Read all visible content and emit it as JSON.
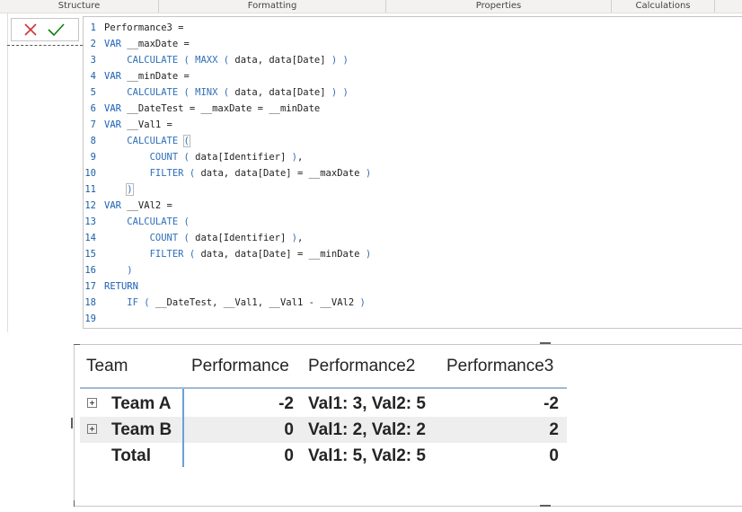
{
  "ribbon": {
    "sections": [
      "Structure",
      "Formatting",
      "Properties",
      "Calculations"
    ]
  },
  "formula_bar": {
    "cancel_icon": "close-icon",
    "commit_icon": "checkmark-icon",
    "lines": [
      {
        "num": "1",
        "tokens": [
          {
            "t": "pl",
            "v": "Performance3 ="
          }
        ]
      },
      {
        "num": "2",
        "tokens": [
          {
            "t": "kw",
            "v": "VAR"
          },
          {
            "t": "pl",
            "v": " __maxDate ="
          }
        ]
      },
      {
        "num": "3",
        "tokens": [
          {
            "t": "pl",
            "v": "    "
          },
          {
            "t": "fn",
            "v": "CALCULATE ( MAXX ("
          },
          {
            "t": "pl",
            "v": " data, data[Date] "
          },
          {
            "t": "fn",
            "v": ") )"
          }
        ]
      },
      {
        "num": "4",
        "tokens": [
          {
            "t": "kw",
            "v": "VAR"
          },
          {
            "t": "pl",
            "v": " __minDate ="
          }
        ]
      },
      {
        "num": "5",
        "tokens": [
          {
            "t": "pl",
            "v": "    "
          },
          {
            "t": "fn",
            "v": "CALCULATE ( MINX ("
          },
          {
            "t": "pl",
            "v": " data, data[Date] "
          },
          {
            "t": "fn",
            "v": ") )"
          }
        ]
      },
      {
        "num": "6",
        "tokens": [
          {
            "t": "kw",
            "v": "VAR"
          },
          {
            "t": "pl",
            "v": " __DateTest = __maxDate = __minDate"
          }
        ]
      },
      {
        "num": "7",
        "tokens": [
          {
            "t": "kw",
            "v": "VAR"
          },
          {
            "t": "pl",
            "v": " __Val1 ="
          }
        ]
      },
      {
        "num": "8",
        "tokens": [
          {
            "t": "pl",
            "v": "    "
          },
          {
            "t": "fn",
            "v": "CALCULATE "
          },
          {
            "t": "hl",
            "v": "("
          }
        ]
      },
      {
        "num": "9",
        "tokens": [
          {
            "t": "pl",
            "v": "        "
          },
          {
            "t": "fn",
            "v": "COUNT ("
          },
          {
            "t": "pl",
            "v": " data[Identifier] "
          },
          {
            "t": "fn",
            "v": ")"
          },
          {
            "t": "pl",
            "v": ","
          }
        ]
      },
      {
        "num": "10",
        "tokens": [
          {
            "t": "pl",
            "v": "        "
          },
          {
            "t": "fn",
            "v": "FILTER ("
          },
          {
            "t": "pl",
            "v": " data, data[Date] = __maxDate "
          },
          {
            "t": "fn",
            "v": ")"
          }
        ]
      },
      {
        "num": "11",
        "tokens": [
          {
            "t": "pl",
            "v": "    "
          },
          {
            "t": "hl",
            "v": ")"
          }
        ]
      },
      {
        "num": "12",
        "tokens": [
          {
            "t": "kw",
            "v": "VAR"
          },
          {
            "t": "pl",
            "v": " __VAl2 ="
          }
        ]
      },
      {
        "num": "13",
        "tokens": [
          {
            "t": "pl",
            "v": "    "
          },
          {
            "t": "fn",
            "v": "CALCULATE ("
          }
        ]
      },
      {
        "num": "14",
        "tokens": [
          {
            "t": "pl",
            "v": "        "
          },
          {
            "t": "fn",
            "v": "COUNT ("
          },
          {
            "t": "pl",
            "v": " data[Identifier] "
          },
          {
            "t": "fn",
            "v": ")"
          },
          {
            "t": "pl",
            "v": ","
          }
        ]
      },
      {
        "num": "15",
        "tokens": [
          {
            "t": "pl",
            "v": "        "
          },
          {
            "t": "fn",
            "v": "FILTER ("
          },
          {
            "t": "pl",
            "v": " data, data[Date] = __minDate "
          },
          {
            "t": "fn",
            "v": ")"
          }
        ]
      },
      {
        "num": "16",
        "tokens": [
          {
            "t": "pl",
            "v": "    "
          },
          {
            "t": "fn",
            "v": ")"
          }
        ]
      },
      {
        "num": "17",
        "tokens": [
          {
            "t": "kw",
            "v": "RETURN"
          }
        ]
      },
      {
        "num": "18",
        "tokens": [
          {
            "t": "pl",
            "v": "    "
          },
          {
            "t": "fn",
            "v": "IF ("
          },
          {
            "t": "pl",
            "v": " __DateTest, __Val1, __Val1 - __VAl2 "
          },
          {
            "t": "fn",
            "v": ")"
          }
        ]
      },
      {
        "num": "19",
        "tokens": []
      }
    ]
  },
  "table": {
    "columns": [
      "Team",
      "Performance",
      "Performance2",
      "Performance3"
    ],
    "rows": [
      {
        "team": "Team A",
        "performance": "-2",
        "performance2": "Val1: 3, Val2: 5",
        "performance3": "-2",
        "expandable": true
      },
      {
        "team": "Team B",
        "performance": "0",
        "performance2": "Val1: 2, Val2: 2",
        "performance3": "2",
        "expandable": true
      }
    ],
    "total": {
      "team": "Total",
      "performance": "0",
      "performance2": "Val1: 5, Val2: 5",
      "performance3": "0"
    }
  },
  "colors": {
    "keyword": "#1b5fb8",
    "cancel": "#d13438",
    "commit": "#107c10",
    "row_divider": "#6aa0d8"
  }
}
